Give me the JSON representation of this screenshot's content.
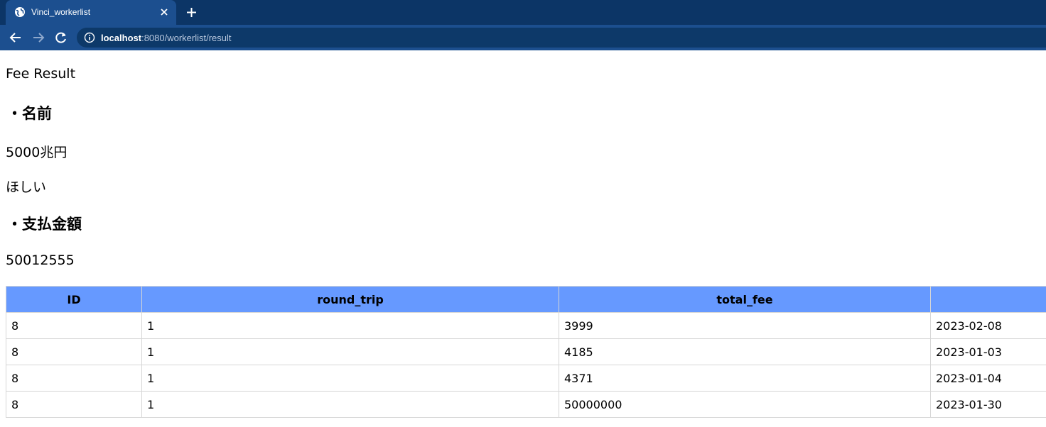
{
  "browser": {
    "tab_title": "Vinci_workerlist",
    "url_host": "localhost",
    "url_rest": ":8080/workerlist/result",
    "icons": {
      "favicon": "globe-icon",
      "tab_close": "close-icon",
      "new_tab": "plus-icon",
      "back": "arrow-left-icon",
      "forward": "arrow-right-icon",
      "reload": "reload-icon",
      "site_info": "info-icon"
    },
    "colors": {
      "tabstrip": "#0c3566",
      "active_tab": "#1c4f8f",
      "omnibox": "#0d3969"
    }
  },
  "page": {
    "heading": "Fee Result",
    "name_section": {
      "title": "・名前",
      "value": "5000兆円",
      "note": "ほしい"
    },
    "amount_section": {
      "title": "・支払金額",
      "value": "50012555"
    },
    "table": {
      "header_color": "#6699ff",
      "columns": [
        "ID",
        "round_trip",
        "total_fee",
        ""
      ],
      "rows": [
        [
          "8",
          "1",
          "3999",
          "2023-02-08"
        ],
        [
          "8",
          "1",
          "4185",
          "2023-01-03"
        ],
        [
          "8",
          "1",
          "4371",
          "2023-01-04"
        ],
        [
          "8",
          "1",
          "50000000",
          "2023-01-30"
        ]
      ]
    }
  }
}
